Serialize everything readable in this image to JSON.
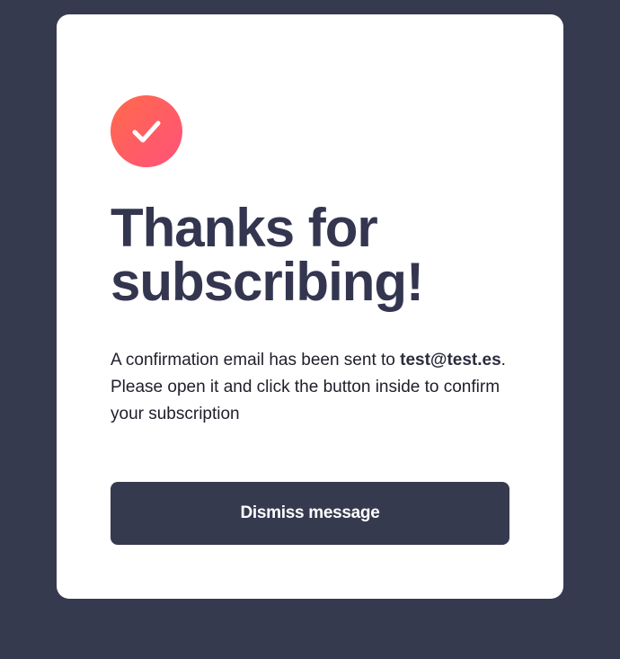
{
  "colors": {
    "background": "#363a4f",
    "card": "#ffffff",
    "title": "#343650",
    "accent_gradient_start": "#ff6a4a",
    "accent_gradient_end": "#ff527b",
    "button": "#363a4f",
    "button_text": "#ffffff"
  },
  "badge": {
    "icon": "check-icon"
  },
  "title": {
    "line1": "Thanks for",
    "line2": "subscribing!"
  },
  "message": {
    "prefix": "A confirmation email has been sent to",
    "email": "test@test.es",
    "suffix": ". Please open it and click the button inside to confirm your subscription"
  },
  "dismiss_button": {
    "label": "Dismiss message"
  }
}
